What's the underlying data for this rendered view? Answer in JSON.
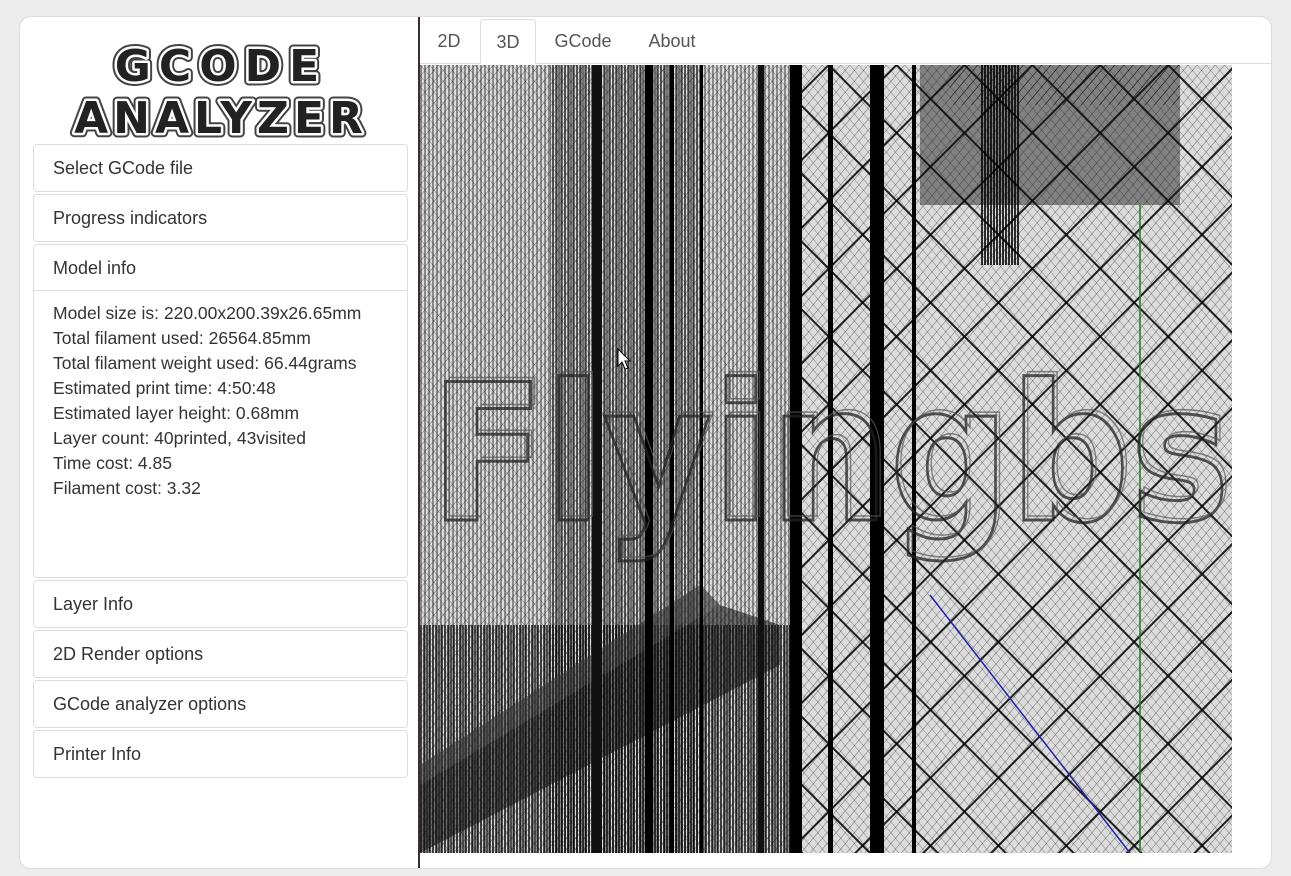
{
  "app": {
    "logo_line1": "GCODE",
    "logo_line2": "ANALYZER"
  },
  "sidebar": {
    "panels": [
      {
        "label": "Select GCode file"
      },
      {
        "label": "Progress indicators"
      },
      {
        "label": "Model info"
      },
      {
        "label": "Layer Info"
      },
      {
        "label": "2D Render options"
      },
      {
        "label": "GCode analyzer options"
      },
      {
        "label": "Printer Info"
      }
    ],
    "model_info": {
      "lines": [
        "Model size is: 220.00x200.39x26.65mm",
        "Total filament used: 26564.85mm",
        "Total filament weight used: 66.44grams",
        "Estimated print time: 4:50:48",
        "Estimated layer height: 0.68mm",
        "Layer count: 40printed, 43visited",
        "Time cost: 4.85",
        "Filament cost: 3.32"
      ]
    }
  },
  "tabs": [
    {
      "label": "2D"
    },
    {
      "label": "3D"
    },
    {
      "label": "GCode"
    },
    {
      "label": "About"
    }
  ],
  "active_tab": "3D",
  "render": {
    "watermark_text": "Flyingbs"
  },
  "colors": {
    "accent_blue": "#2222aa",
    "accent_green": "#1e7a1e"
  }
}
